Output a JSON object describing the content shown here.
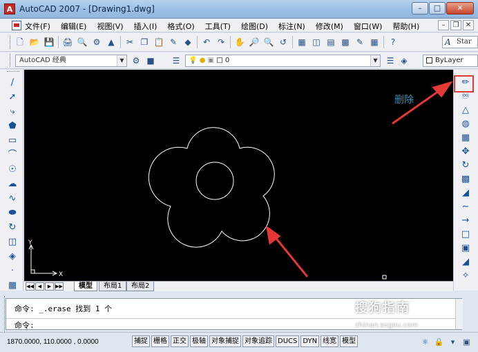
{
  "window": {
    "title": "AutoCAD 2007 - [Drawing1.dwg]",
    "app_icon_glyph": "A"
  },
  "menu": {
    "items": [
      "文件(F)",
      "编辑(E)",
      "视图(V)",
      "插入(I)",
      "格式(O)",
      "工具(T)",
      "绘图(D)",
      "标注(N)",
      "修改(M)",
      "窗口(W)",
      "帮助(H)"
    ]
  },
  "toolbar": {
    "text_style_value": "Star"
  },
  "workspace": {
    "selected": "AutoCAD 经典"
  },
  "layer": {
    "current": "0",
    "color_control": "ByLayer"
  },
  "canvas": {
    "annotation": "删除",
    "ucs_x_label": "X",
    "ucs_y_label": "Y",
    "background_color": "#000000",
    "entity_color": "#ffffff",
    "arrow_color": "#e53935"
  },
  "tabs": {
    "items": [
      "模型",
      "布局1",
      "布局2"
    ],
    "active": "模型"
  },
  "command": {
    "history": "命令:  _.erase 找到 1 个",
    "prompt": "命令:"
  },
  "status": {
    "coordinates": "1870.0000, 110.0000 , 0.0000",
    "toggles": [
      "捕捉",
      "栅格",
      "正交",
      "极轴",
      "对象捕捉",
      "对象追踪",
      "DUCS",
      "DYN",
      "线宽",
      "模型"
    ]
  },
  "watermark": {
    "main": "搜狗指南",
    "sub": "zhinan.sogou.com"
  }
}
